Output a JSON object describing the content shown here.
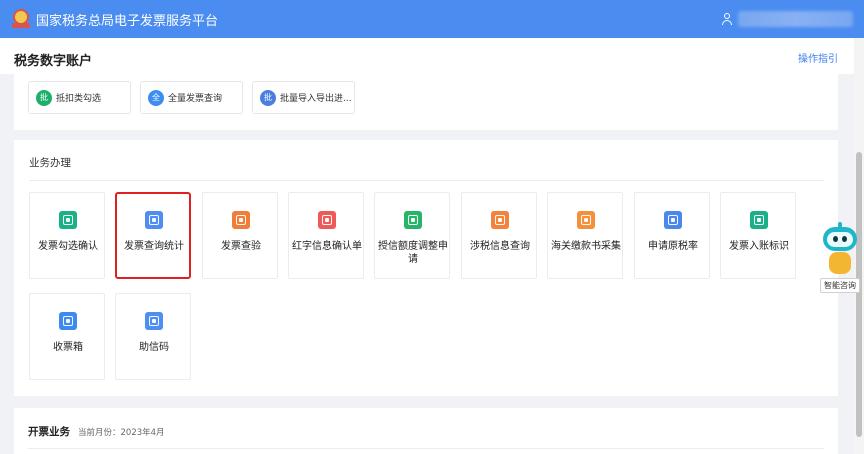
{
  "header": {
    "brand_title": "国家税务总局电子发票服务平台"
  },
  "page": {
    "title": "税务数字账户",
    "help_link": "操作指引"
  },
  "quick_actions": [
    {
      "badge": "批",
      "label": "抵扣类勾选",
      "color": "#1db06b"
    },
    {
      "badge": "全",
      "label": "全量发票查询",
      "color": "#3d8ef0"
    },
    {
      "badge": "批",
      "label": "批量导入导出进...",
      "color": "#4a7fe0"
    }
  ],
  "business": {
    "section_title": "业务办理",
    "tiles": [
      {
        "label": "发票勾选确认",
        "color": "#1bb087",
        "icon": "invoice-check-icon"
      },
      {
        "label": "发票查询统计",
        "color": "#4f8df0",
        "icon": "invoice-search-icon"
      },
      {
        "label": "发票查验",
        "color": "#f07d38",
        "icon": "ticket-verify-icon"
      },
      {
        "label": "红字信息确认单",
        "color": "#ee5a5a",
        "icon": "red-document-icon"
      },
      {
        "label": "授信额度调整申请",
        "color": "#27b46a",
        "icon": "credit-adjust-icon"
      },
      {
        "label": "涉税信息查询",
        "color": "#f3823b",
        "icon": "tax-info-search-icon"
      },
      {
        "label": "海关缴款书采集",
        "color": "#f4903a",
        "icon": "customs-payment-icon"
      },
      {
        "label": "申请原税率",
        "color": "#4a88ee",
        "icon": "tax-rate-apply-icon"
      },
      {
        "label": "发票入账标识",
        "color": "#1bb087",
        "icon": "invoice-booking-icon"
      },
      {
        "label": "收票箱",
        "color": "#3d8bf0",
        "icon": "mailbox-icon"
      },
      {
        "label": "助信码",
        "color": "#4d8ff2",
        "icon": "qr-code-icon"
      }
    ]
  },
  "invoicing": {
    "title": "开票业务",
    "month_text": "当前月份：2023年4月"
  },
  "assistant": {
    "label": "智能咨询"
  }
}
